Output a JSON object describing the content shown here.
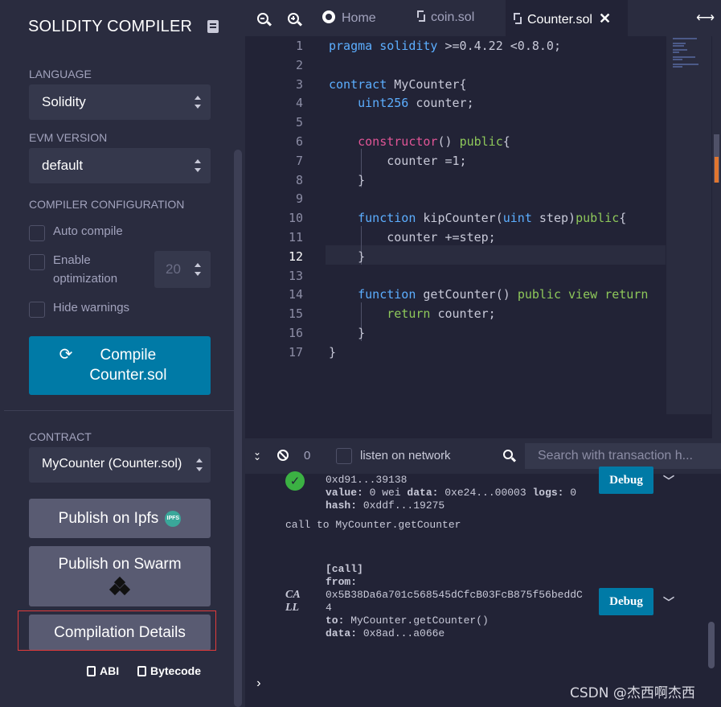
{
  "sidebar": {
    "title": "SOLIDITY COMPILER",
    "language_label": "LANGUAGE",
    "language_value": "Solidity",
    "evm_label": "EVM VERSION",
    "evm_value": "default",
    "config_label": "COMPILER CONFIGURATION",
    "auto_compile": "Auto compile",
    "enable_optimization": "Enable optimization",
    "optimization_runs": "20",
    "hide_warnings": "Hide warnings",
    "compile_button": "Compile Counter.sol",
    "contract_label": "CONTRACT",
    "contract_value": "MyCounter (Counter.sol)",
    "publish_ipfs": "Publish on Ipfs",
    "ipfs_badge": "IPFS",
    "publish_swarm": "Publish on Swarm",
    "compilation_details": "Compilation Details",
    "abi_link": "ABI",
    "bytecode_link": "Bytecode"
  },
  "tabs": [
    {
      "label": "Home",
      "icon": "home-icon"
    },
    {
      "label": "coin.sol",
      "icon": "solidity-icon"
    },
    {
      "label": "Counter.sol",
      "icon": "solidity-icon",
      "active": true
    }
  ],
  "editor": {
    "current_line": 12,
    "lines": [
      "pragma solidity >=0.4.22 <0.8.0;",
      "",
      "contract MyCounter{",
      "    uint256 counter;",
      "",
      "    constructor() public{",
      "        counter =1;",
      "    }",
      "",
      "    function kipCounter(uint step)public{",
      "        counter +=step;",
      "    }",
      "",
      "    function getCounter() public view return",
      "        return counter;",
      "    }",
      "}"
    ]
  },
  "terminal": {
    "pending_count": "0",
    "listen_label": "listen on network",
    "search_placeholder": "Search with transaction h...",
    "tx1": {
      "from_line": "0xd91...39138",
      "value_key": "value:",
      "value_val": " 0 wei ",
      "data_key": "data:",
      "data_val": " 0xe24...00003 ",
      "logs_key": "logs:",
      "logs_val": " 0",
      "hash_key": "hash:",
      "hash_val": " 0xddf...19275",
      "debug": "Debug"
    },
    "call_text": "call to MyCounter.getCounter",
    "tx2": {
      "label": "CA\nLL",
      "call_tag": "[call]",
      "from_key": "from:",
      "from_val_1": "0x5B38Da6a701c568545dCfcB03FcB875f56beddC",
      "from_val_2": "4",
      "to_key": "to:",
      "to_val": " MyCounter.getCounter()",
      "data_key": "data:",
      "data_val": " 0x8ad...a066e",
      "debug": "Debug"
    },
    "watermark": "CSDN @杰西啊杰西"
  }
}
